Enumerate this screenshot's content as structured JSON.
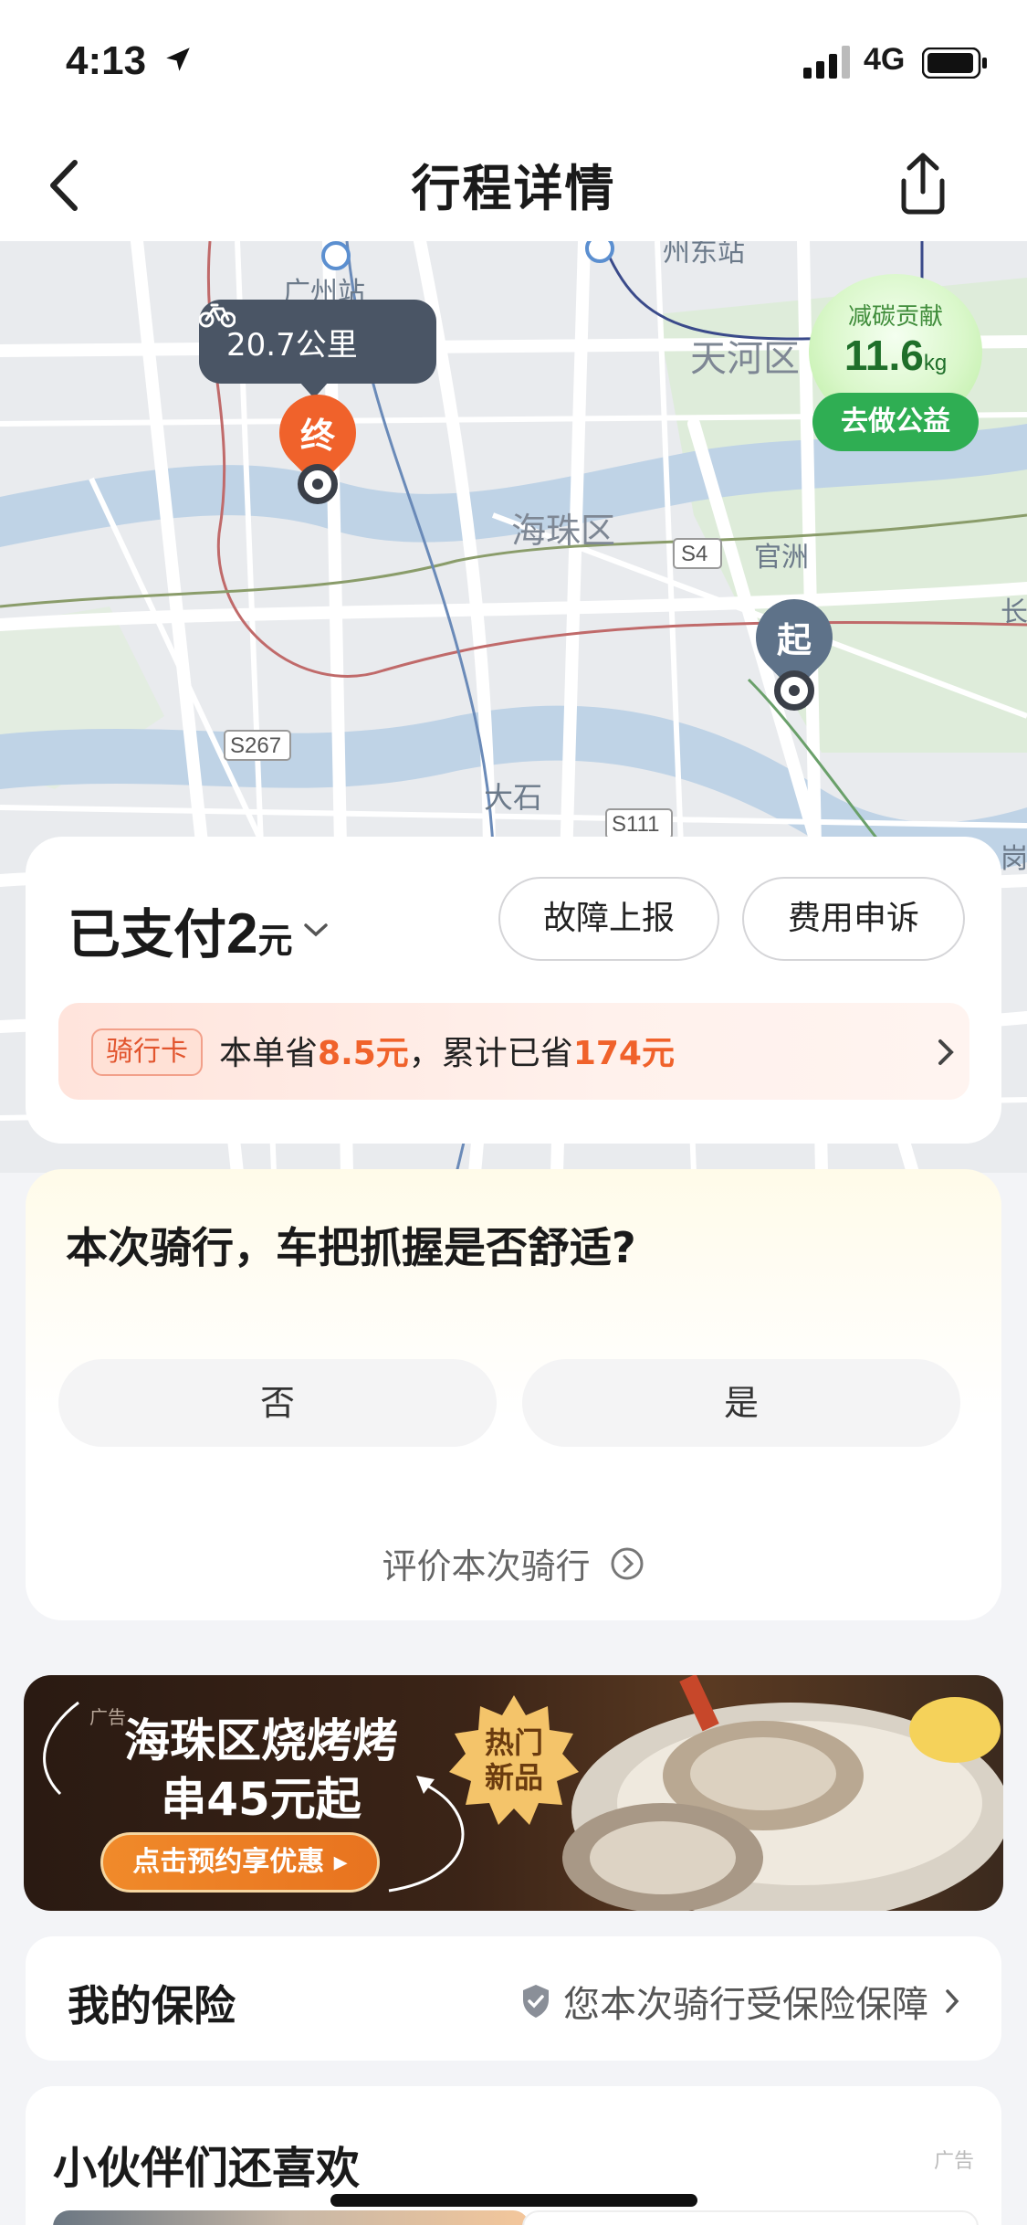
{
  "status_bar": {
    "time": "4:13",
    "network": "4G"
  },
  "nav": {
    "title": "行程详情"
  },
  "map": {
    "labels": {
      "guangzhou_station": "广州站",
      "guangzhou_east": "州东站",
      "tianhe": "天河区",
      "haizhu": "海珠区",
      "s4": "S4",
      "guanzhou": "官洲",
      "s267": "S267",
      "dashi": "大石",
      "s111": "S111",
      "edge_right": "长",
      "edge_right2": "岗"
    },
    "distance": "20.7公里",
    "end_pin": "终",
    "start_pin": "起",
    "carbon": {
      "label": "减碳贡献",
      "value": "11.6",
      "unit": "kg",
      "button": "去做公益"
    }
  },
  "payment": {
    "prefix": "已支付",
    "amount": "2",
    "unit": "元",
    "report_button": "故障上报",
    "appeal_button": "费用申诉",
    "ride_card": {
      "badge": "骑行卡",
      "text_a": "本单省",
      "saved": "8.5元",
      "text_b": "，累计已省",
      "total": "174元"
    }
  },
  "survey": {
    "question": "本次骑行，车把抓握是否舒适?",
    "option_no": "否",
    "option_yes": "是",
    "rate_link": "评价本次骑行"
  },
  "banner": {
    "ad_tag": "广告",
    "title_line1": "海珠区烧烤烤",
    "title_line2": "串45元起",
    "cta": "点击预约享优惠 ▸",
    "hot_line1": "热门",
    "hot_line2": "新品"
  },
  "insurance": {
    "title": "我的保险",
    "status": "您本次骑行受保险保障"
  },
  "recommend": {
    "title": "小伙伴们还喜欢",
    "ad_tag": "广告"
  },
  "colors": {
    "accent_orange": "#f0622b",
    "green": "#2fae53",
    "pin_start": "#5e7289"
  }
}
